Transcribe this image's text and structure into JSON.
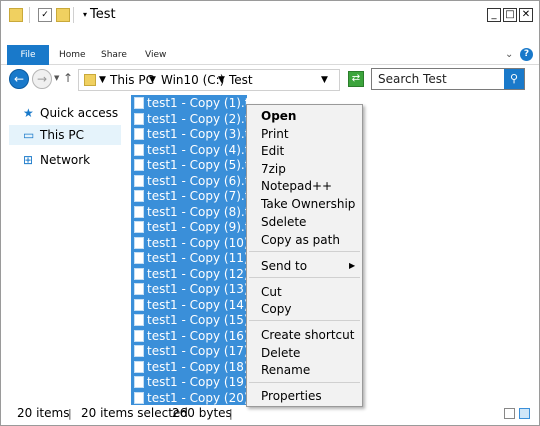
{
  "window": {
    "title": "Test",
    "controls": {
      "minimize": "_",
      "maximize": "□",
      "close": "✕"
    }
  },
  "ribbon": {
    "file": "File",
    "tabs": [
      "Home",
      "Share",
      "View"
    ],
    "collapse": "⌄",
    "help": "?"
  },
  "address": {
    "crumbs": [
      "This PC",
      "Win10 (C:)",
      "Test"
    ],
    "search_placeholder": "Search Test"
  },
  "navpane": {
    "items": [
      {
        "label": "Quick access",
        "icon": "star-icon"
      },
      {
        "label": "This PC",
        "icon": "computer-icon"
      },
      {
        "label": "Network",
        "icon": "network-icon"
      }
    ]
  },
  "files": [
    "test1 - Copy (1).txt",
    "test1 - Copy (2).txt",
    "test1 - Copy (3).txt",
    "test1 - Copy (4).txt",
    "test1 - Copy (5).txt",
    "test1 - Copy (6).txt",
    "test1 - Copy (7).txt",
    "test1 - Copy (8).txt",
    "test1 - Copy (9).txt",
    "test1 - Copy (10).txt",
    "test1 - Copy (11).txt",
    "test1 - Copy (12).txt",
    "test1 - Copy (13).txt",
    "test1 - Copy (14).txt",
    "test1 - Copy (15).txt",
    "test1 - Copy (16).txt",
    "test1 - Copy (17).txt",
    "test1 - Copy (18).txt",
    "test1 - Copy (19).txt",
    "test1 - Copy (20).txt"
  ],
  "context_menu": {
    "open": "Open",
    "print": "Print",
    "edit": "Edit",
    "sevenzip": "7zip",
    "notepadpp": "Notepad++",
    "take_ownership": "Take Ownership",
    "sdelete": "Sdelete",
    "copy_as_path": "Copy as path",
    "send_to": "Send to",
    "cut": "Cut",
    "copy": "Copy",
    "create_shortcut": "Create shortcut",
    "delete": "Delete",
    "rename": "Rename",
    "properties": "Properties"
  },
  "status": {
    "item_count": "20 items",
    "selected": "20 items selected",
    "size": "260 bytes"
  }
}
